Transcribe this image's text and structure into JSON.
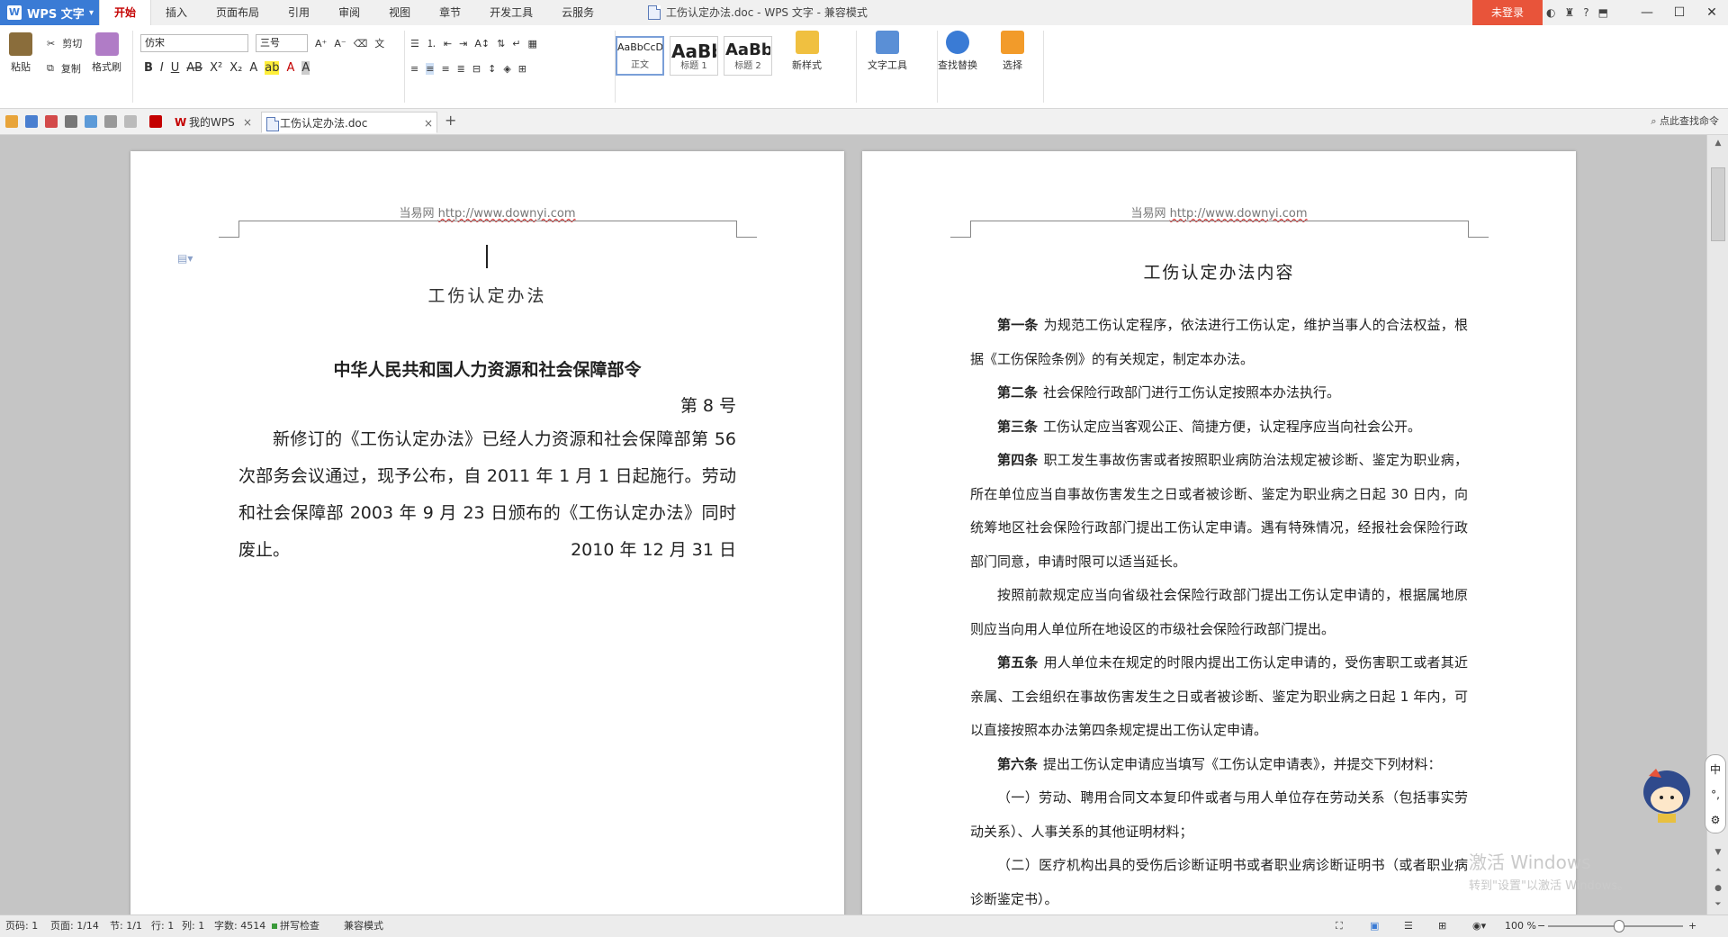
{
  "app": {
    "name": "WPS 文字",
    "window_title": "工伤认定办法.doc - WPS 文字 - 兼容模式",
    "login": "未登录"
  },
  "ribbon_tabs": [
    "开始",
    "插入",
    "页面布局",
    "引用",
    "审阅",
    "视图",
    "章节",
    "开发工具",
    "云服务"
  ],
  "ribbon": {
    "paste": "粘贴",
    "cut": "剪切",
    "copy": "复制",
    "format_painter": "格式刷",
    "font_name": "仿宋",
    "font_size": "三号",
    "styles": [
      {
        "preview": "AaBbCcDd",
        "caption": "正文"
      },
      {
        "preview": "AaBb",
        "caption": "标题 1"
      },
      {
        "preview": "AaBb(",
        "caption": "标题 2"
      }
    ],
    "new_style": "新样式",
    "text_tools": "文字工具",
    "find_replace": "查找替换",
    "select": "选择"
  },
  "tabs": {
    "my_wps": "我的WPS",
    "doc": "工伤认定办法.doc",
    "search_cmd": "点此查找命令"
  },
  "page1": {
    "header_site": "当易网",
    "header_url": "http://www.downyi.com",
    "title": "工伤认定办法",
    "heading": "中华人民共和国人力资源和社会保障部令",
    "number": "第 8 号",
    "body": "新修订的《工伤认定办法》已经人力资源和社会保障部第 56 次部务会议通过，现予公布，自 2011 年 1 月 1 日起施行。劳动和社会保障部 2003 年 9 月 23 日颁布的《工伤认定办法》同时废止。",
    "date": "2010 年 12 月 31 日"
  },
  "page2": {
    "header_site": "当易网",
    "header_url": "http://www.downyi.com",
    "title": "工伤认定办法内容",
    "paragraphs": [
      {
        "label": "第一条",
        "text": "为规范工伤认定程序，依法进行工伤认定，维护当事人的合法权益，根据《工伤保险条例》的有关规定，制定本办法。"
      },
      {
        "label": "第二条",
        "text": "社会保险行政部门进行工伤认定按照本办法执行。"
      },
      {
        "label": "第三条",
        "text": "工伤认定应当客观公正、简捷方便，认定程序应当向社会公开。"
      },
      {
        "label": "第四条",
        "text": "职工发生事故伤害或者按照职业病防治法规定被诊断、鉴定为职业病，所在单位应当自事故伤害发生之日或者被诊断、鉴定为职业病之日起 30 日内，向统筹地区社会保险行政部门提出工伤认定申请。遇有特殊情况，经报社会保险行政部门同意，申请时限可以适当延长。"
      },
      {
        "label": "",
        "text": "按照前款规定应当向省级社会保险行政部门提出工伤认定申请的，根据属地原则应当向用人单位所在地设区的市级社会保险行政部门提出。"
      },
      {
        "label": "第五条",
        "text": "用人单位未在规定的时限内提出工伤认定申请的，受伤害职工或者其近亲属、工会组织在事故伤害发生之日或者被诊断、鉴定为职业病之日起 1 年内，可以直接按照本办法第四条规定提出工伤认定申请。"
      },
      {
        "label": "第六条",
        "text": "提出工伤认定申请应当填写《工伤认定申请表》，并提交下列材料："
      },
      {
        "label": "",
        "text": "（一）劳动、聘用合同文本复印件或者与用人单位存在劳动关系（包括事实劳动关系）、人事关系的其他证明材料；"
      },
      {
        "label": "",
        "text": "（二）医疗机构出具的受伤后诊断证明书或者职业病诊断证明书（或者职业病诊断鉴定书）。"
      }
    ]
  },
  "status": {
    "page_code": "页码: 1",
    "page": "页面: 1/14",
    "section": "节: 1/1",
    "row": "行: 1",
    "col": "列: 1",
    "words": "字数: 4514",
    "spell": "拼写检查",
    "compat": "兼容模式",
    "zoom": "100 %"
  },
  "watermark": {
    "line1": "激活 Windows",
    "line2": "转到\"设置\"以激活 Windows。"
  },
  "ime": {
    "lang": "中"
  },
  "colors": {
    "accent": "#c40000",
    "app_blue": "#3a7bd5",
    "login": "#e8543a"
  }
}
